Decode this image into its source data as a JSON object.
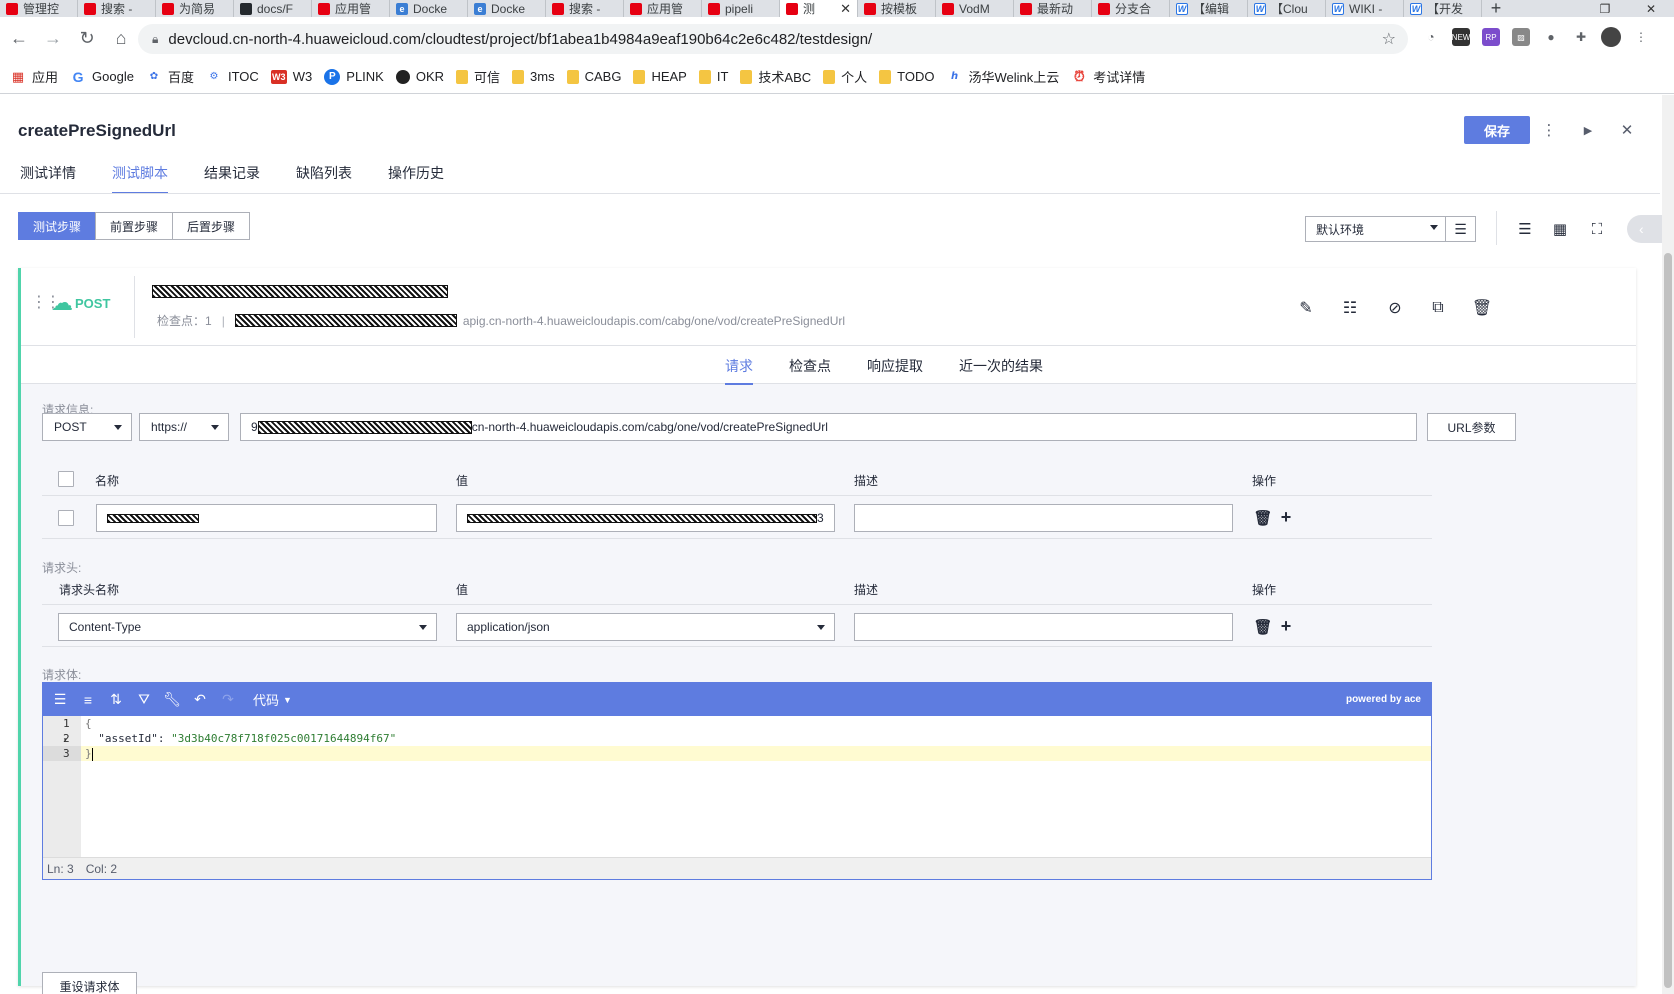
{
  "browser": {
    "tabs": [
      {
        "label": "管理控",
        "icon": "huawei-icon"
      },
      {
        "label": "搜索 -",
        "icon": "huawei-icon"
      },
      {
        "label": "为简易",
        "icon": "huawei-icon"
      },
      {
        "label": "docs/F",
        "icon": "github-icon"
      },
      {
        "label": "应用管",
        "icon": "huawei-icon"
      },
      {
        "label": "Docke",
        "icon": "edge-icon"
      },
      {
        "label": "Docke",
        "icon": "edge-icon"
      },
      {
        "label": "搜索 -",
        "icon": "huawei-icon"
      },
      {
        "label": "应用管",
        "icon": "huawei-icon"
      },
      {
        "label": "pipeli",
        "icon": "huawei-icon"
      },
      {
        "label": "测",
        "icon": "huawei-icon",
        "active": true
      },
      {
        "label": "按模板",
        "icon": "huawei-icon"
      },
      {
        "label": "VodM",
        "icon": "huawei-icon"
      },
      {
        "label": "最新动",
        "icon": "huawei-icon"
      },
      {
        "label": "分支合",
        "icon": "huawei-icon"
      },
      {
        "label": "【编辑",
        "icon": "welink-icon"
      },
      {
        "label": "【Clou",
        "icon": "welink-icon"
      },
      {
        "label": "WIKI -",
        "icon": "welink-icon"
      },
      {
        "label": "【开发",
        "icon": "welink-icon"
      }
    ],
    "new_tab": "+",
    "url": "devcloud.cn-north-4.huaweicloud.com/cloudtest/project/bf1abea1b4984a9eaf190b64c2e6c482/testdesign/",
    "bookmarks": [
      {
        "label": "应用",
        "icon": "apps-grid-icon"
      },
      {
        "label": "Google",
        "icon": "google-icon"
      },
      {
        "label": "百度",
        "icon": "baidu-icon"
      },
      {
        "label": "ITOC",
        "icon": "itoc-icon"
      },
      {
        "label": "W3",
        "icon": "w3-icon"
      },
      {
        "label": "PLINK",
        "icon": "plink-icon"
      },
      {
        "label": "OKR",
        "icon": "okr-icon"
      },
      {
        "label": "可信",
        "icon": "folder-icon"
      },
      {
        "label": "3ms",
        "icon": "folder-icon"
      },
      {
        "label": "CABG",
        "icon": "folder-icon"
      },
      {
        "label": "HEAP",
        "icon": "folder-icon"
      },
      {
        "label": "IT",
        "icon": "folder-icon"
      },
      {
        "label": "技术ABC",
        "icon": "folder-icon"
      },
      {
        "label": "个人",
        "icon": "folder-icon"
      },
      {
        "label": "TODO",
        "icon": "folder-icon"
      },
      {
        "label": "汤华Welink上云",
        "icon": "welink-icon"
      },
      {
        "label": "考试详情",
        "icon": "alarm-icon"
      }
    ]
  },
  "page": {
    "title": "createPreSignedUrl",
    "save_label": "保存",
    "main_tabs": [
      "测试详情",
      "测试脚本",
      "结果记录",
      "缺陷列表",
      "操作历史"
    ],
    "step_tabs": [
      "测试步骤",
      "前置步骤",
      "后置步骤"
    ],
    "environment": "默认环境"
  },
  "step": {
    "method_label": "POST",
    "checkpoint_label": "检查点：",
    "checkpoint_count": "1",
    "url_suffix": "apig.cn-north-4.huaweicloudapis.com/cabg/one/vod/createPreSignedUrl",
    "sub_tabs": [
      "请求",
      "检查点",
      "响应提取",
      "近一次的结果"
    ]
  },
  "request": {
    "info_label": "请求信息:",
    "method": "POST",
    "protocol": "https://",
    "url_prefix": "9",
    "url_suffix": "cn-north-4.huaweicloudapis.com/cabg/one/vod/createPreSignedUrl",
    "url_params_label": "URL参数",
    "params_headers": {
      "name": "名称",
      "value": "值",
      "desc": "描述",
      "ops": "操作"
    },
    "params_row": {
      "value_tail": "3",
      "desc": ""
    },
    "headers_label": "请求头:",
    "headers_headers": {
      "name": "请求头名称",
      "value": "值",
      "desc": "描述",
      "ops": "操作"
    },
    "header_row": {
      "name": "Content-Type",
      "value": "application/json",
      "desc": ""
    },
    "body_label": "请求体:",
    "reset_label": "重设请求体"
  },
  "editor": {
    "code_label": "代码",
    "powered_by": "powered by ace",
    "line_numbers": [
      "1",
      "2",
      "3"
    ],
    "line1": "{",
    "line2_key": "  \"assetId\": ",
    "line2_val": "\"3d3b40c78f718f025c00171644894f67\"",
    "line3": "}",
    "ln_status": "Ln: 3",
    "col_status": "Col: 2"
  }
}
